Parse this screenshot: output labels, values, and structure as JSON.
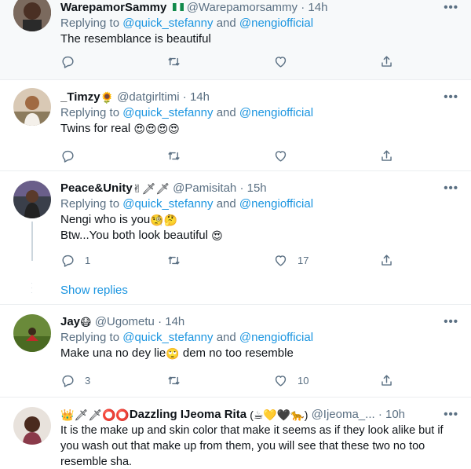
{
  "tweets": [
    {
      "name": "WarepamorSammy",
      "handle": "@Warepamorsammy",
      "time": "14h",
      "replying_prefix": "Replying to",
      "mention1": "@quick_stefanny",
      "and": "and",
      "mention2": "@nengiofficial",
      "text": "The resemblance is beautiful",
      "counts": {
        "reply": "",
        "retweet": "",
        "like": ""
      }
    },
    {
      "name": "_Timzy",
      "name_emoji": "🌻",
      "handle": "@datgirltimi",
      "time": "14h",
      "replying_prefix": "Replying to",
      "mention1": "@quick_stefanny",
      "and": "and",
      "mention2": "@nengiofficial",
      "text": "Twins for real",
      "text_emoji": "😍😍😍😍",
      "counts": {
        "reply": "",
        "retweet": "",
        "like": ""
      }
    },
    {
      "name": "Peace&Unity",
      "name_emoji": "✌🗡🗡",
      "handle": "@Pamisitah",
      "time": "15h",
      "replying_prefix": "Replying to",
      "mention1": "@quick_stefanny",
      "and": "and",
      "mention2": "@nengiofficial",
      "text_line1": "Nengi who is you",
      "text_line1_emoji": "🧐🤔",
      "text_line2": "Btw...You both look beautiful",
      "text_line2_emoji": "😍",
      "counts": {
        "reply": "1",
        "retweet": "",
        "like": "17"
      },
      "show_replies": "Show replies"
    },
    {
      "name": "Jay",
      "name_emoji": "😷",
      "handle": "@Ugometu",
      "time": "14h",
      "replying_prefix": "Replying to",
      "mention1": "@quick_stefanny",
      "and": "and",
      "mention2": "@nengiofficial",
      "text_before": "Make una no dey lie",
      "text_emoji": "🙄",
      "text_after": " dem no too resemble",
      "counts": {
        "reply": "3",
        "retweet": "",
        "like": "10"
      }
    },
    {
      "name_prefix_emoji": "👑🗡🗡⭕⭕",
      "name": "Dazzling IJeoma Rita",
      "name_suffix": "(☕💛🖤🐆)",
      "handle": "@Ijeoma_...",
      "time": "10h",
      "text_line1": "It is the make up and skin color that make it seems as if they look alike but if",
      "text_line2": "you wash out that make up from them, you will see that these two no too",
      "text_line3": "resemble sha."
    }
  ],
  "icons": {
    "reply": "reply-icon",
    "retweet": "retweet-icon",
    "like": "heart-icon",
    "share": "share-icon",
    "more": "more-icon"
  },
  "colors": {
    "link": "#1b95e0",
    "secondary": "#5b7083",
    "text": "#0f1419",
    "border": "#ebeef0",
    "highlight_bg": "#f7f9fa"
  },
  "more_glyph": "•••",
  "separator": "·"
}
